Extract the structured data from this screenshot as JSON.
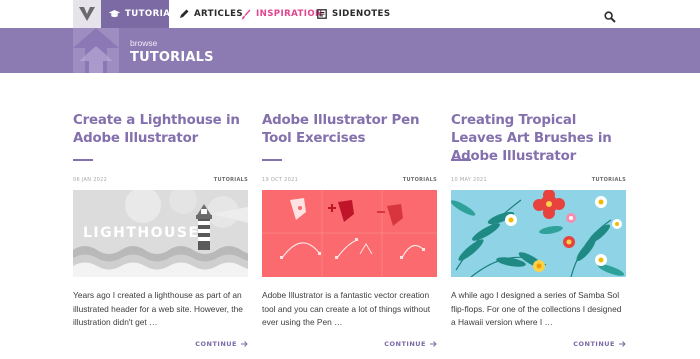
{
  "nav": {
    "logo_icon": "v-logo-icon",
    "items": [
      {
        "label": "TUTORIALS",
        "icon": "graduation-cap-icon",
        "active": true
      },
      {
        "label": "ARTICLES",
        "icon": "pen-icon"
      },
      {
        "label": "INSPIRATION",
        "icon": "paint-brush-icon"
      },
      {
        "label": "SIDENOTES",
        "icon": "notepad-icon"
      }
    ],
    "search_icon": "search-icon"
  },
  "banner": {
    "browse_label": "browse",
    "title": "TUTORIALS"
  },
  "cards": [
    {
      "title": "Create a Lighthouse in Adobe Illustrator",
      "date": "06 JAN 2022",
      "category": "TUTORIALS",
      "thumb_text": "LIGHTHOUSE",
      "excerpt": "Years ago I created a lighthouse as part of an illustrated header for a web site. However, the illustration didn't get …",
      "continue_label": "CONTINUE"
    },
    {
      "title": "Adobe Illustrator Pen Tool Exercises",
      "date": "19 OCT 2021",
      "category": "TUTORIALS",
      "excerpt": "Adobe Illustrator is a fantastic vector creation tool and you can create a lot of things without ever using the Pen …",
      "continue_label": "CONTINUE"
    },
    {
      "title": "Creating Tropical Leaves Art Brushes in Adobe Illustrator",
      "date": "10 MAY 2021",
      "category": "TUTORIALS",
      "excerpt": "A while ago I designed a series of Samba Sol flip-flops. For one of the collections I designed a Hawaii version where I …",
      "continue_label": "CONTINUE"
    }
  ],
  "colors": {
    "accent": "#7b6aa3",
    "banner": "#8c7bb2",
    "title": "#8470ad",
    "inspiration": "#e2458f"
  }
}
